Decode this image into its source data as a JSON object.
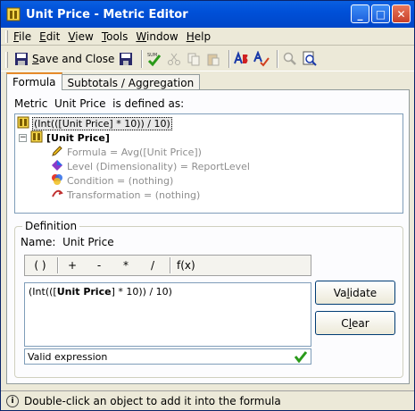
{
  "window": {
    "title": "Unit Price - Metric Editor",
    "min_glyph": "_",
    "max_glyph": "□",
    "close_glyph": "✕"
  },
  "menu": [
    {
      "label": "File",
      "accel": "F",
      "rest": "ile"
    },
    {
      "label": "Edit",
      "accel": "E",
      "rest": "dit"
    },
    {
      "label": "View",
      "accel": "V",
      "rest": "iew"
    },
    {
      "label": "Tools",
      "accel": "T",
      "rest": "ools"
    },
    {
      "label": "Window",
      "accel": "W",
      "rest": "indow"
    },
    {
      "label": "Help",
      "accel": "H",
      "rest": "elp"
    }
  ],
  "toolbar": {
    "save_close_prefix": "",
    "save_close_accel": "S",
    "save_close_rest": "ave and Close",
    "sum_label": "SUM"
  },
  "tabs": [
    "Formula",
    "Subtotals / Aggregation"
  ],
  "formula_tab": {
    "defined_prefix": "Metric",
    "metric_name": "Unit Price",
    "defined_suffix": "is defined as:",
    "tree": {
      "root": "(Int(([Unit Price] * 10)) / 10)",
      "fact": "[Unit Price]",
      "children": [
        "Formula = Avg([Unit Price])",
        "Level (Dimensionality) = ReportLevel",
        "Condition = (nothing)",
        "Transformation = (nothing)"
      ]
    },
    "definition": {
      "group_label": "Definition",
      "name_label": "Name:",
      "name_value": "Unit Price",
      "operators": [
        "( )",
        "+",
        "-",
        "*",
        "/",
        "f(x)"
      ],
      "formula_pre": "(Int(([",
      "formula_bold": "Unit Price",
      "formula_post": "] * 10)) / 10)",
      "status_text": "Valid expression",
      "validate_accel": "l",
      "validate_pre": "Va",
      "validate_post": "idate",
      "clear_accel": "l",
      "clear_pre": "C",
      "clear_post": "ear"
    }
  },
  "statusbar": {
    "text": "Double-click an object to add it into the formula"
  },
  "colors": {
    "titlebar": "#0050d8",
    "valid_check": "#2a9a1a"
  }
}
